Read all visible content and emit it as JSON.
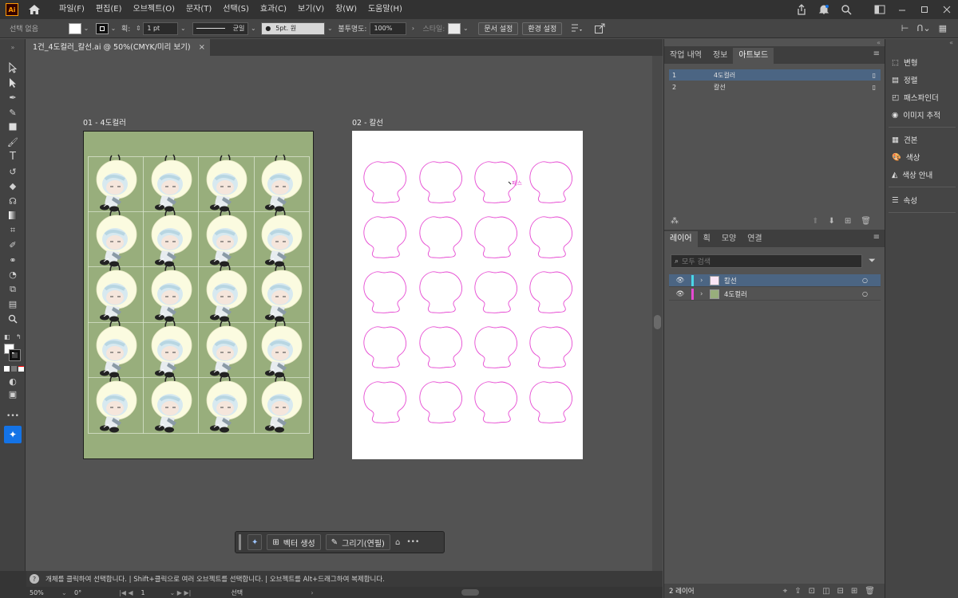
{
  "app": {
    "logo_text": "Ai"
  },
  "menu": [
    "파일(F)",
    "편집(E)",
    "오브젝트(O)",
    "문자(T)",
    "선택(S)",
    "효과(C)",
    "보기(V)",
    "창(W)",
    "도움말(H)"
  ],
  "control_bar": {
    "selection_label": "선택 없음",
    "stroke_label": "획:",
    "stroke_weight": "1 pt",
    "stroke_style": "균일",
    "brush_label": "5pt. 원",
    "opacity_label": "불투명도:",
    "opacity_value": "100%",
    "style_label": "스타일:",
    "doc_setup_button": "문서 설정",
    "preferences_button": "환경 설정"
  },
  "document": {
    "tab_title": "1건_4도컬러_칼선.ai @ 50%(CMYK/미리 보기)",
    "close_glyph": "×",
    "artboards": [
      {
        "label": "01 - 4도컬러"
      },
      {
        "label": "02 - 칼선"
      }
    ],
    "path_hint_label": "패스"
  },
  "context_bar": {
    "vector_button": "벡터 생성",
    "draw_button": "그리기(연필)",
    "more_glyph": "•••"
  },
  "hint_bar": {
    "text": "개체를 클릭하여 선택합니다. | Shift+클릭으로 여러 오브젝트를 선택합니다. | 오브젝트를 Alt+드래그하여 복제합니다."
  },
  "status_bar": {
    "zoom": "50%",
    "rotation": "0°",
    "artboard_number": "1",
    "tool_name": "선택"
  },
  "right_panel": {
    "top_tabs": [
      "작업 내역",
      "정보",
      "아트보드"
    ],
    "artboard_list": [
      {
        "num": "1",
        "name": "4도컬러"
      },
      {
        "num": "2",
        "name": "칼선"
      }
    ],
    "layer_tabs": [
      "레이어",
      "획",
      "모양",
      "연결"
    ],
    "layer_search_placeholder": "모두 검색",
    "layers": [
      {
        "name": "칼선",
        "color": "#4ad6e6"
      },
      {
        "name": "4도컬러",
        "color": "#e64ad2"
      }
    ],
    "layer_count": "2 레이어"
  },
  "dock": {
    "items": [
      "변형",
      "정렬",
      "패스파인더",
      "이미지 추적",
      "견본",
      "색상",
      "색상 안내",
      "속성"
    ]
  },
  "colors": {
    "artboard_green": "#98ae7c",
    "cutline_pink": "#e64ad2",
    "selection_blue": "#4b6583",
    "accent_blue": "#1473e6"
  }
}
